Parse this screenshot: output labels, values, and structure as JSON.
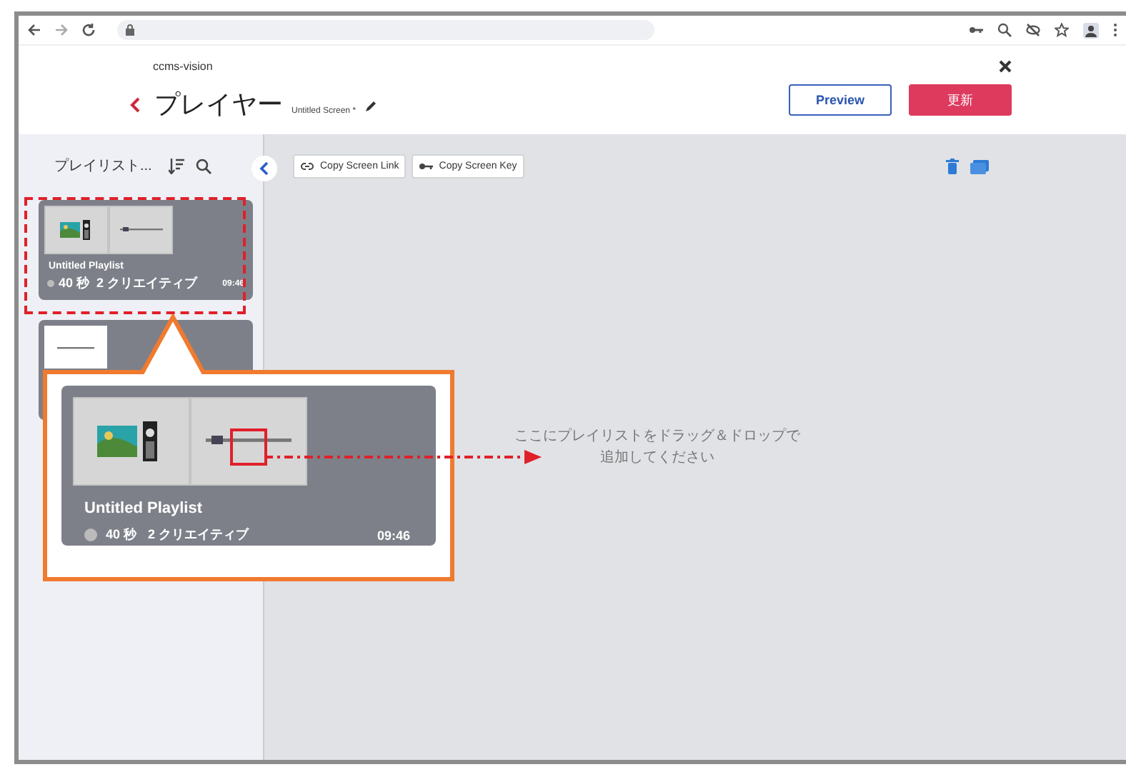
{
  "app_header": {
    "logo": "ccms-vision",
    "title": "プレイヤー",
    "screen_name": "Untitled Screen *",
    "buttons": [
      {
        "label": "Preview",
        "kind": "outline"
      },
      {
        "label": "更新",
        "kind": "primary"
      }
    ]
  },
  "sidebar": {
    "heading": "プレイリスト...",
    "playlists": [
      {
        "kind": "full",
        "title": "Untitled Playlist",
        "duration": "40 秒",
        "creatives": "2 クリエイティブ",
        "time": "09:46"
      },
      {
        "kind": "covered"
      }
    ]
  },
  "toolbar": {
    "buttons": [
      {
        "label": "Copy Screen Link",
        "kind": "link"
      },
      {
        "label": "Copy Screen Key",
        "kind": "key"
      }
    ]
  },
  "drop_zone": {
    "hint_lines": [
      "ここにプレイリストをドラッグ＆ドロップで",
      "追加してください"
    ]
  },
  "callout": {
    "title": "Untitled Playlist",
    "duration": "40 秒",
    "creatives": "2 クリエイティブ",
    "time": "09:46"
  }
}
